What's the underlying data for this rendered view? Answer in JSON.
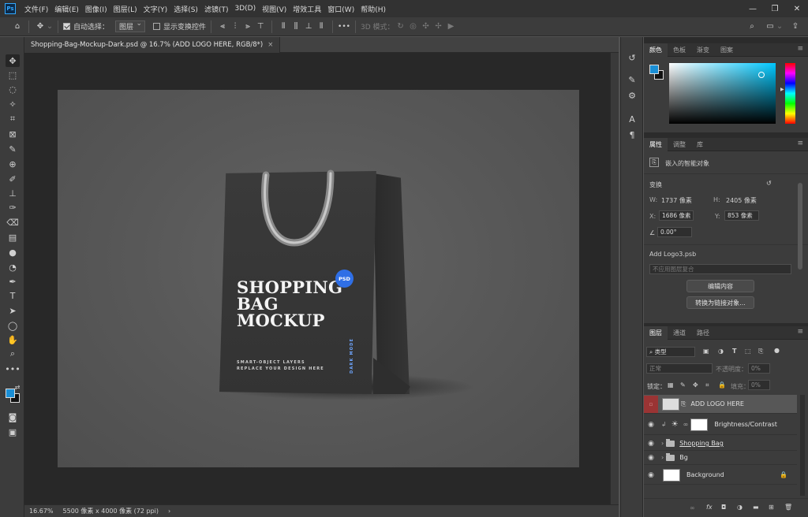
{
  "menubar": {
    "logo": "Ps",
    "items": [
      "文件(F)",
      "编辑(E)",
      "图像(I)",
      "图层(L)",
      "文字(Y)",
      "选择(S)",
      "滤镜(T)",
      "3D(D)",
      "视图(V)",
      "增效工具",
      "窗口(W)",
      "帮助(H)"
    ],
    "window_controls": [
      "—",
      "❐",
      "✕"
    ]
  },
  "optionsbar": {
    "auto_select_label": "自动选择：",
    "auto_select_value": "图层",
    "show_transform_label": "显示变换控件",
    "more": "•••",
    "mode_3d_label": "3D 模式："
  },
  "document": {
    "tab_title": "Shopping-Bag-Mockup-Dark.psd @ 16.7% (ADD LOGO HERE, RGB/8*)",
    "close": "×"
  },
  "artwork": {
    "title_lines": [
      "SHOPPING",
      "BAG",
      "MOCKUP"
    ],
    "badge": "PSD",
    "subtitle_lines": [
      "SMART-OBJECT LAYERS",
      "REPLACE YOUR DESIGN HERE"
    ],
    "side_text": "DARK MODE"
  },
  "statusbar": {
    "zoom": "16.67%",
    "doc_info": "5500 像素 x 4000 像素 (72 ppi)",
    "arrow": "›"
  },
  "color_panel": {
    "tabs": [
      "颜色",
      "色板",
      "渐变",
      "图案"
    ],
    "foreground": "#1a8fd6",
    "background": "#111111",
    "hue": "#00c8ff"
  },
  "properties_panel": {
    "tabs": [
      "属性",
      "调整",
      "库"
    ],
    "type_label": "嵌入的智能对象",
    "transform_label": "变换",
    "w_label": "W:",
    "w_value": "1737 像素",
    "h_label": "H:",
    "h_value": "2405 像素",
    "x_label": "X:",
    "x_value": "1686 像素",
    "y_label": "Y:",
    "y_value": "853 像素",
    "angle_value": "0.00°",
    "source_file": "Add Logo3.psb",
    "comp_placeholder": "不应用图层复合",
    "edit_button": "编辑内容",
    "convert_button": "转换为链接对象..."
  },
  "layers_panel": {
    "tabs": [
      "图层",
      "通道",
      "路径"
    ],
    "filter_label": "类型",
    "blend_mode": "正常",
    "opacity_label": "不透明度：",
    "opacity_value": "0%",
    "lock_label": "锁定：",
    "fill_label": "填充：",
    "fill_value": "0%",
    "layers": [
      {
        "name": "ADD LOGO HERE"
      },
      {
        "name": "Brightness/Contrast"
      },
      {
        "name": "Shopping Bag"
      },
      {
        "name": "Bg"
      },
      {
        "name": "Background"
      }
    ],
    "footer_icons": [
      "link",
      "fx",
      "mask",
      "adjust",
      "folder",
      "new",
      "trash"
    ]
  }
}
